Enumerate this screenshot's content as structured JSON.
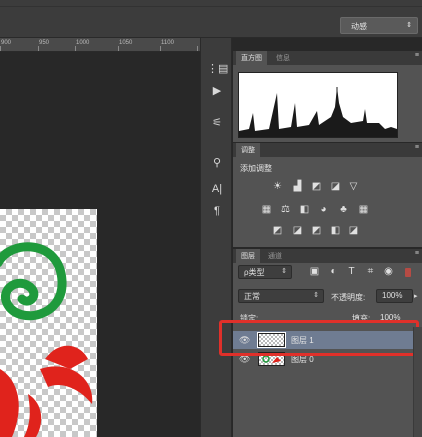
{
  "workspace": {
    "label": "动感",
    "arrow": "⇕"
  },
  "ruler": {
    "ticks": [
      "900",
      "950",
      "1000",
      "1050",
      "1100"
    ]
  },
  "histogram_panel": {
    "tabs": [
      "直方图",
      "信息"
    ],
    "menu": "≡"
  },
  "adjustments_panel": {
    "tabs": [
      "调整"
    ],
    "title": "添加调整",
    "menu": "≡",
    "icons_row1": [
      "☀",
      "▟",
      "◩",
      "◪",
      "▽"
    ],
    "icons_row2": [
      "▦",
      "⚖",
      "◧",
      "◕",
      "♣",
      "▦"
    ],
    "icons_row3": [
      "◩",
      "◪",
      "◩",
      "◧",
      "◪"
    ]
  },
  "layers_panel": {
    "tabs": [
      "图层",
      "通道"
    ],
    "menu": "≡",
    "filter_kind": "ρ类型",
    "filter_icons": [
      "▣",
      "◐",
      "T",
      "⌗",
      "◉"
    ],
    "blend_mode": "正常",
    "opacity_label": "不透明度:",
    "opacity_value": "100%",
    "lock_label": "锁定:",
    "fill_label": "填充:",
    "fill_value": "100%",
    "layers": [
      {
        "name": "图层 1",
        "visible_icon": "👁",
        "selected": true
      },
      {
        "name": "图层 0",
        "visible_icon": "👁",
        "selected": false
      }
    ]
  },
  "toolstrip": {
    "tools": [
      "⋮▤",
      "▶",
      "⚟",
      "⚲",
      "A|",
      "¶"
    ]
  },
  "colors": {
    "panel": "#535353",
    "dark": "#282828",
    "highlight": "#e0302a",
    "green": "#1f9a3c",
    "red": "#e0231c"
  }
}
